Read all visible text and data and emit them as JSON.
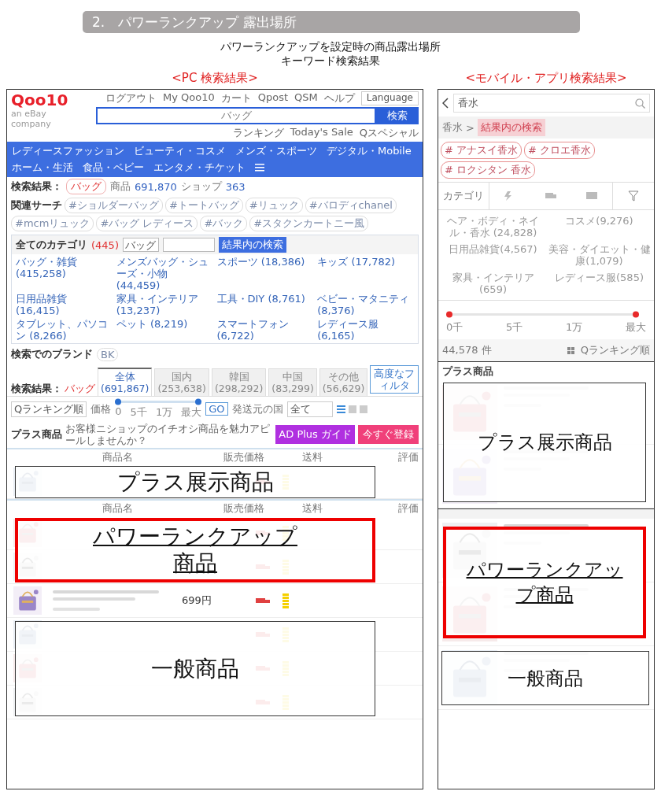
{
  "header": {
    "title": "2.　パワーランクアップ 露出場所"
  },
  "subtitle": [
    "パワーランクアップを設定時の商品露出場所",
    "キーワード検索結果"
  ],
  "pc": {
    "caption": "<PC 検索結果>",
    "top_links": [
      "ログアウト",
      "My Qoo10",
      "カート",
      "Qpost",
      "QSM",
      "ヘルプ"
    ],
    "language": "Language",
    "logo": "Qoo10",
    "logo_sub": "an eBay company",
    "search": {
      "value": "バッグ",
      "button": "検索"
    },
    "sub_links": [
      "ランキング",
      "Today's Sale",
      "Qスペシャル"
    ],
    "nav": [
      "レディースファッション",
      "ビューティ・コスメ",
      "メンズ・スポーツ",
      "デジタル・Mobile",
      "ホーム・生活",
      "食品・ベビー",
      "エンタメ・チケット"
    ],
    "result": {
      "label": "検索結果：",
      "keyword": "バッグ",
      "items_label": "商品",
      "items_count": "691,870",
      "shops_label": "ショップ",
      "shops_count": "363"
    },
    "related": {
      "label": "関連サーチ",
      "tags": [
        "#ショルダーバッグ",
        "#トートバッグ",
        "#リュック",
        "#バロディchanel",
        "#mcmリュック",
        "#バッグ レディース",
        "#バック",
        "#スタクンカートニー風"
      ]
    },
    "categories": {
      "label": "全てのカテゴリ",
      "count": "(445)",
      "keyword": "バッグ",
      "button": "結果内の検索",
      "items": [
        "バッグ・雑貨 (415,258)",
        "メンズバッグ・シューズ・小物 (44,459)",
        "スポーツ (18,386)",
        "キッズ (17,782)",
        "日用品雑貨 (16,415)",
        "家具・インテリア (13,237)",
        "工具・DIY (8,761)",
        "ベビー・マタニティ (8,376)",
        "タブレット、パソコン (8,266)",
        "ペット (8,219)",
        "スマートフォン (6,722)",
        "レディース服 (6,165)"
      ]
    },
    "brand": {
      "label": "検索でのブランド",
      "tag": "BK"
    },
    "tabs_label": "検索結果：",
    "tabs_keyword": "バッグ",
    "tabs": [
      {
        "label": "全体",
        "count": "(691,867)",
        "selected": true
      },
      {
        "label": "国内",
        "count": "(253,638)",
        "selected": false
      },
      {
        "label": "韓国",
        "count": "(298,292)",
        "selected": false
      },
      {
        "label": "中国",
        "count": "(83,299)",
        "selected": false
      },
      {
        "label": "その他",
        "count": "(56,629)",
        "selected": false
      }
    ],
    "filter": "高度なフィルタ",
    "sort": {
      "order": "Qランキング順",
      "price_label": "価格",
      "level": 1,
      "ticks": [
        "0",
        "5千",
        "1万",
        "最大"
      ],
      "go": "GO",
      "country_label": "発送元の国",
      "country": "全て"
    },
    "plus": {
      "label": "プラス商品",
      "promo": "お客様ニショップのイチオシ商品を魅力アピールしませんか？",
      "guide": "AD Plus ガイド",
      "register": "今すぐ登録"
    },
    "columns": [
      "商品名",
      "販売価格",
      "送料",
      "評価"
    ],
    "columns_2": [
      "商品名",
      "販売価格",
      "送料",
      "評価"
    ],
    "price": "699円",
    "overlays": {
      "plus": "プラス展示商品",
      "power": "パワーランクアップ商品",
      "general": "一般商品"
    }
  },
  "mobile": {
    "caption": "<モバイル・アプリ検索結果>",
    "search": "香水",
    "crumb": "香水",
    "crumb_separator": ">",
    "inner_search": "結果内の検索",
    "tags": [
      "# アナスイ香水",
      "# クロエ香水",
      "# ロクシタン 香水"
    ],
    "tab": "カテゴリ",
    "categories": [
      "ヘア・ボディ・ネイル・香水 (24,828)",
      "コスメ(9,276)",
      "日用品雑貨(4,567)",
      "美容・ダイエット・健康(1,079)",
      "家具・インテリア(659)",
      "レディース服(585)"
    ],
    "level": 1,
    "ticks": [
      "0千",
      "5千",
      "1万",
      "最大"
    ],
    "count": "44,578 件",
    "sort": "Qランキング順",
    "plus_label": "プラス商品",
    "overlays": {
      "plus": "プラス展示商品",
      "power": "パワーランクアップ商品",
      "general": "一般商品"
    }
  }
}
